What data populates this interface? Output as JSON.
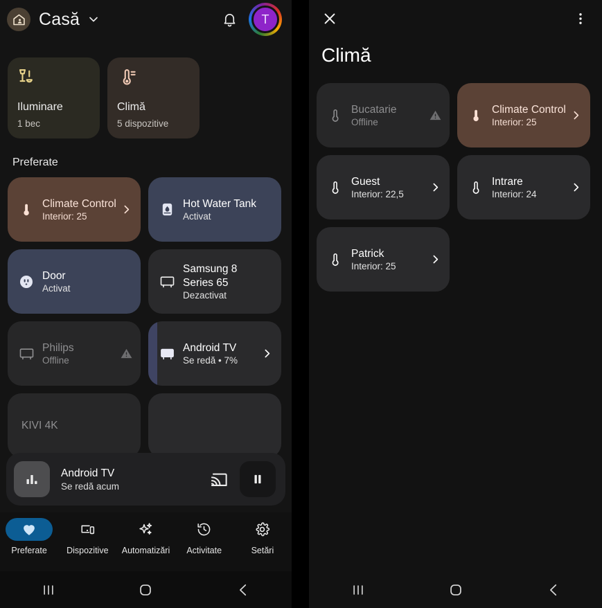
{
  "left": {
    "header": {
      "home_icon": "home-person-icon",
      "title": "Casă",
      "chevron_icon": "chevron-down-icon",
      "bell_icon": "notification-bell-icon",
      "avatar_initial": "T"
    },
    "categories": [
      {
        "icon": "lamp-icon",
        "name": "Iluminare",
        "sub": "1 bec"
      },
      {
        "icon": "thermometer-icon",
        "name": "Climă",
        "sub": "5 dispozitive"
      }
    ],
    "favorites_title": "Preferate",
    "devices": [
      {
        "name": "Climate Control",
        "state": "Interior: 25",
        "icon": "thermometer-icon",
        "style": "brown",
        "chevron": true,
        "warning": false
      },
      {
        "name": "Hot Water Tank",
        "state": "Activat",
        "icon": "water-heater-icon",
        "style": "slate",
        "chevron": false,
        "warning": false
      },
      {
        "name": "Door",
        "state": "Activat",
        "icon": "outlet-icon",
        "style": "slate",
        "chevron": false,
        "warning": false
      },
      {
        "name": "Samsung 8 Series 65",
        "state": "Dezactivat",
        "icon": "tv-icon",
        "style": "plain",
        "chevron": false,
        "warning": false
      },
      {
        "name": "Philips",
        "state": "Offline",
        "icon": "tv-icon",
        "style": "offline",
        "chevron": false,
        "warning": true
      },
      {
        "name": "Android TV",
        "state": "Se redă • 7%",
        "icon": "tv-icon",
        "style": "plain",
        "chevron": true,
        "warning": false,
        "progress_percent": 7
      },
      {
        "name": "KIVI 4K",
        "state": "",
        "icon": "tv-icon",
        "style": "offline",
        "chevron": false,
        "warning": false
      },
      {
        "name": "",
        "state": "",
        "icon": "tv-icon",
        "style": "plain",
        "chevron": false,
        "warning": false
      }
    ],
    "media": {
      "thumb_icon": "equalizer-icon",
      "title": "Android TV",
      "subtitle": "Se redă acum",
      "cast_icon": "cast-icon",
      "pause_icon": "pause-icon"
    },
    "tabs": [
      {
        "label": "Preferate",
        "icon": "heart-icon",
        "active": true
      },
      {
        "label": "Dispozitive",
        "icon": "devices-icon",
        "active": false
      },
      {
        "label": "Automatizări",
        "icon": "sparkle-icon",
        "active": false
      },
      {
        "label": "Activitate",
        "icon": "history-icon",
        "active": false
      },
      {
        "label": "Setări",
        "icon": "gear-icon",
        "active": false
      }
    ]
  },
  "right": {
    "close_icon": "close-icon",
    "overflow_icon": "more-vertical-icon",
    "title": "Climă",
    "devices": [
      {
        "name": "Bucatarie",
        "state": "Offline",
        "icon": "thermometer-icon",
        "style": "offline",
        "chevron": false,
        "warning": true
      },
      {
        "name": "Climate Control",
        "state": "Interior: 25",
        "icon": "thermometer-icon",
        "style": "brown",
        "chevron": true,
        "warning": false
      },
      {
        "name": "Guest",
        "state": "Interior: 22,5",
        "icon": "thermometer-icon",
        "style": "plain",
        "chevron": true,
        "warning": false
      },
      {
        "name": "Intrare",
        "state": "Interior: 24",
        "icon": "thermometer-icon",
        "style": "plain",
        "chevron": true,
        "warning": false
      },
      {
        "name": "Patrick",
        "state": "Interior: 25",
        "icon": "thermometer-icon",
        "style": "plain",
        "chevron": true,
        "warning": false
      }
    ]
  },
  "sysnav": {
    "recents_icon": "recents-icon",
    "home_icon": "home-square-icon",
    "back_icon": "back-chevron-icon"
  },
  "colors": {
    "accent_tab": "#0c5d94",
    "card_brown": "#5b4236",
    "card_slate": "#3c4358",
    "card_plain": "#2a2a2c",
    "card_offline": "#272728",
    "progress_fill": "#3f4463",
    "lamp_icon": "#e8d38a",
    "thermo_icon": "#f0c9b4"
  }
}
